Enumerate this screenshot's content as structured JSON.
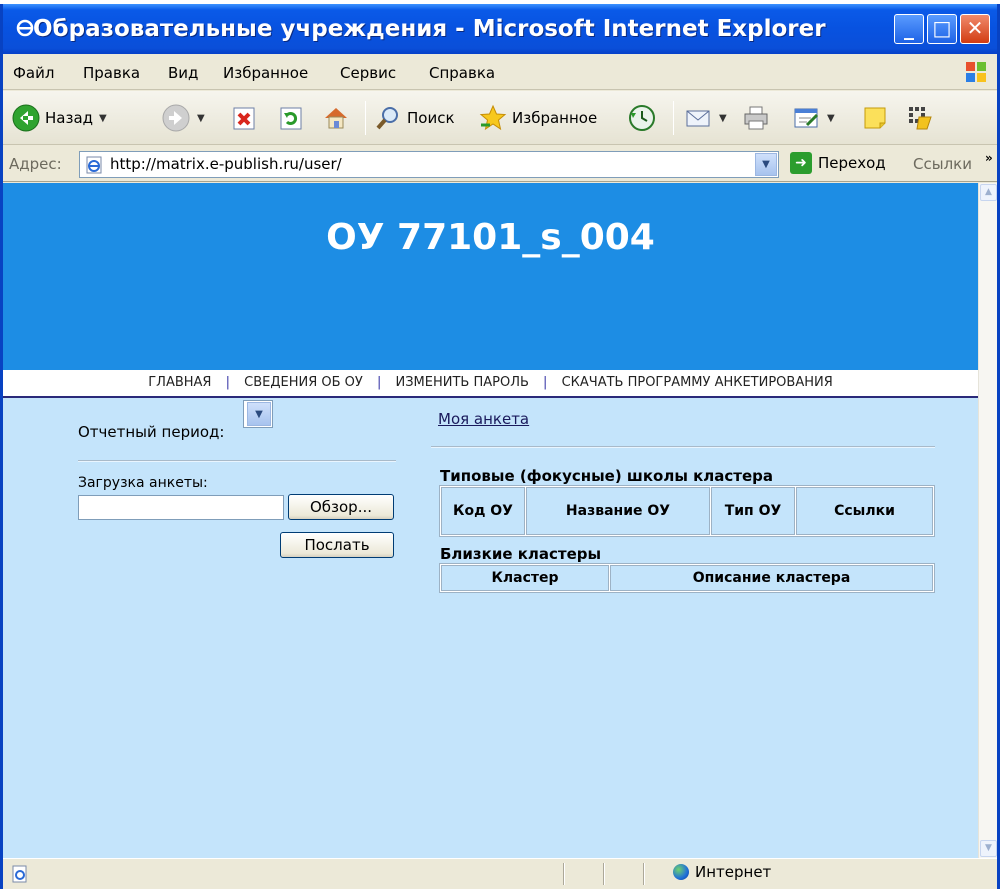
{
  "window": {
    "title": "Образовательные учреждения - Microsoft Internet Explorer",
    "minimize_glyph": "_",
    "maximize_glyph": "□",
    "close_glyph": "✕"
  },
  "menu": [
    {
      "label": "Файл"
    },
    {
      "label": "Правка"
    },
    {
      "label": "Вид"
    },
    {
      "label": "Избранное"
    },
    {
      "label": "Сервис"
    },
    {
      "label": "Справка"
    }
  ],
  "toolbar": {
    "back_label": "Назад",
    "search_label": "Поиск",
    "favorites_label": "Избранное"
  },
  "address": {
    "label": "Адрес:",
    "url": "http://matrix.e-publish.ru/user/",
    "go_label": "Переход",
    "links_label": "Ссылки",
    "more_glyph": "»"
  },
  "page": {
    "banner_title": "ОУ 77101_s_004",
    "nav": [
      "ГЛАВНАЯ",
      "СВЕДЕНИЯ ОБ ОУ",
      "ИЗМЕНИТЬ ПАРОЛЬ",
      "СКАЧАТЬ ПРОГРАММУ АНКЕТИРОВАНИЯ"
    ],
    "nav_separator": "|",
    "period_label": "Отчетный период:",
    "upload_label": "Загрузка анкеты:",
    "browse_label": "Обзор...",
    "send_label": "Послать",
    "my_form_link": "Моя анкета",
    "typical_schools_title": "Типовые (фокусные) школы кластера",
    "typical_schools_columns": [
      "Код ОУ",
      "Название ОУ",
      "Тип ОУ",
      "Ссылки"
    ],
    "close_clusters_title": "Близкие кластеры",
    "close_clusters_columns": [
      "Кластер",
      "Описание кластера"
    ]
  },
  "status": {
    "zone_label": "Интернет"
  },
  "colors": {
    "banner": "#1d8de4",
    "content_bg": "#c4e4fb",
    "title_bar": "#0a5ae8"
  },
  "icons": [
    "back-icon",
    "forward-icon",
    "stop-icon",
    "refresh-icon",
    "home-icon",
    "search-icon",
    "favorites-star-icon",
    "history-icon",
    "mail-icon",
    "print-icon",
    "edit-icon",
    "notes-icon",
    "messenger-icon",
    "page-icon",
    "go-arrow-icon",
    "globe-icon"
  ]
}
